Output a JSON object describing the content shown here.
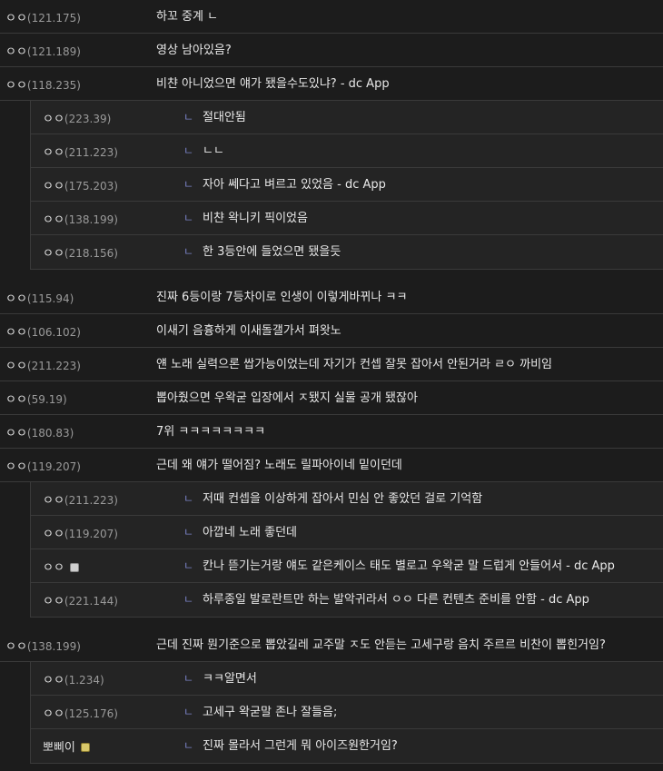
{
  "comments": [
    {
      "nick": "ㅇㅇ",
      "ip": "(121.175)",
      "text": "하꼬 중계 ㄴ",
      "replies": []
    },
    {
      "nick": "ㅇㅇ",
      "ip": "(121.189)",
      "text": "영상 남아있음?",
      "replies": []
    },
    {
      "nick": "ㅇㅇ",
      "ip": "(118.235)",
      "text": "비챤 아니었으면 얘가 됐을수도있냐? - dc App",
      "replies": [
        {
          "nick": "ㅇㅇ",
          "ip": "(223.39)",
          "text": "절대안됨"
        },
        {
          "nick": "ㅇㅇ",
          "ip": "(211.223)",
          "text": "ㄴㄴ"
        },
        {
          "nick": "ㅇㅇ",
          "ip": "(175.203)",
          "text": "자아 쎄다고 벼르고 있었음 - dc App"
        },
        {
          "nick": "ㅇㅇ",
          "ip": "(138.199)",
          "text": "비챤 왁니키 픽이었음"
        },
        {
          "nick": "ㅇㅇ",
          "ip": "(218.156)",
          "text": "한 3등안에 들었으면 됐을듯"
        }
      ]
    },
    {
      "nick": "ㅇㅇ",
      "ip": "(115.94)",
      "text": "진짜 6등이랑 7등차이로 인생이 이렇게바뀌나 ㅋㅋ",
      "replies": []
    },
    {
      "nick": "ㅇㅇ",
      "ip": "(106.102)",
      "text": "이새기 음흉하게 이새돌갤가서 펴왓노",
      "replies": []
    },
    {
      "nick": "ㅇㅇ",
      "ip": "(211.223)",
      "text": "얜 노래 실력으론 쌉가능이었는데 자기가 컨셉 잘못 잡아서 안된거라 ㄹㅇ 까비임",
      "replies": []
    },
    {
      "nick": "ㅇㅇ",
      "ip": "(59.19)",
      "text": "뽑아줬으면 우왁굳 입장에서 ㅈ됐지 실물 공개 됐잖아",
      "replies": []
    },
    {
      "nick": "ㅇㅇ",
      "ip": "(180.83)",
      "text": "7위 ㅋㅋㅋㅋㅋㅋㅋㅋ",
      "replies": []
    },
    {
      "nick": "ㅇㅇ",
      "ip": "(119.207)",
      "text": "근데 왜 얘가 떨어짐? 노래도 릴파아이네 밑이던데",
      "replies": [
        {
          "nick": "ㅇㅇ",
          "ip": "(211.223)",
          "text": "저때 컨셉을 이상하게 잡아서 민심 안 좋았던 걸로 기억함"
        },
        {
          "nick": "ㅇㅇ",
          "ip": "(119.207)",
          "text": "아깝네 노래 좋던데"
        },
        {
          "nick": "ㅇㅇ",
          "ip": "",
          "badge": "fixed",
          "text": "칸나 뜯기는거랑 얘도 같은케이스 태도 별로고 우왁굳 말 드럽게 안들어서 - dc App"
        },
        {
          "nick": "ㅇㅇ",
          "ip": "(221.144)",
          "text": "하루종일 발로란트만 하는 발악귀라서 ㅇㅇ 다른 컨텐츠 준비를 안함 - dc App"
        }
      ]
    },
    {
      "nick": "ㅇㅇ",
      "ip": "(138.199)",
      "text": "근데 진짜 뭔기준으로 뽑았길레 교주말 ㅈ도 안듣는 고세구랑 음치 주르르 비찬이 뽑힌거임?",
      "replies": [
        {
          "nick": "ㅇㅇ",
          "ip": "(1.234)",
          "text": "ㅋㅋ알면서"
        },
        {
          "nick": "ㅇㅇ",
          "ip": "(125.176)",
          "text": "고세구 왁굳말 존나 잘들음;"
        },
        {
          "nick": "뽀삐이",
          "ip": "",
          "badge": "gold",
          "text": "진짜 몰라서 그런게 뭐 아이즈원한거임?"
        }
      ]
    }
  ],
  "icons": {
    "reply_arrow": "ㄴ"
  }
}
